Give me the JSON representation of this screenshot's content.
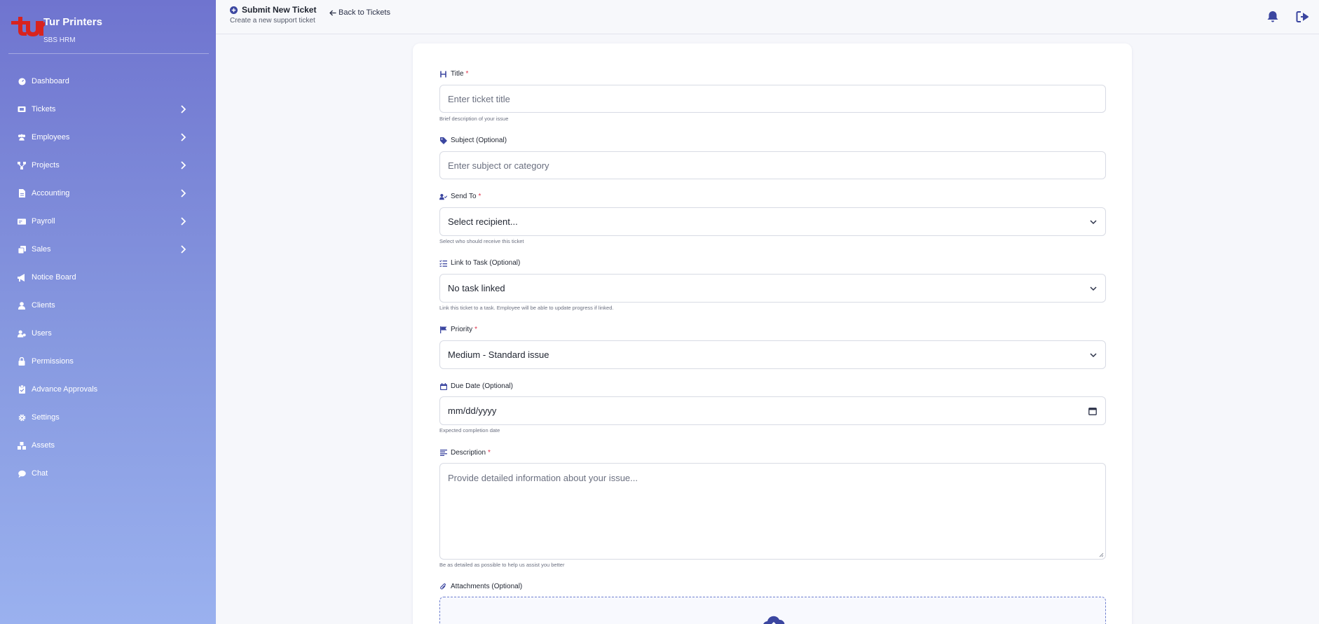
{
  "brand": {
    "name": "Tur Printers",
    "subtitle": "SBS HRM",
    "logo_text": "tur"
  },
  "sidebar": {
    "items": [
      {
        "label": "Dashboard",
        "icon": "dashboard-icon",
        "expandable": false
      },
      {
        "label": "Tickets",
        "icon": "ticket-icon",
        "expandable": true
      },
      {
        "label": "Employees",
        "icon": "users-group-icon",
        "expandable": true
      },
      {
        "label": "Projects",
        "icon": "project-diagram-icon",
        "expandable": true
      },
      {
        "label": "Accounting",
        "icon": "file-invoice-icon",
        "expandable": true
      },
      {
        "label": "Payroll",
        "icon": "money-check-icon",
        "expandable": true
      },
      {
        "label": "Sales",
        "icon": "copy-icon",
        "expandable": true
      },
      {
        "label": "Notice Board",
        "icon": "megaphone-icon",
        "expandable": false
      },
      {
        "label": "Clients",
        "icon": "user-icon",
        "expandable": false
      },
      {
        "label": "Users",
        "icon": "user-gear-icon",
        "expandable": false
      },
      {
        "label": "Permissions",
        "icon": "lock-icon",
        "expandable": false
      },
      {
        "label": "Advance Approvals",
        "icon": "clipboard-check-icon",
        "expandable": false
      },
      {
        "label": "Settings",
        "icon": "gear-icon",
        "expandable": false
      },
      {
        "label": "Assets",
        "icon": "boxes-icon",
        "expandable": false
      },
      {
        "label": "Chat",
        "icon": "chat-icon",
        "expandable": false
      }
    ]
  },
  "header": {
    "title": "Submit New Ticket",
    "subtitle": "Create a new support ticket",
    "back_label": "Back to Tickets"
  },
  "form": {
    "title": {
      "label": "Title",
      "required": "*",
      "placeholder": "Enter ticket title",
      "hint": "Brief description of your issue"
    },
    "subject": {
      "label": "Subject (Optional)",
      "placeholder": "Enter subject or category"
    },
    "send_to": {
      "label": "Send To",
      "required": "*",
      "value": "Select recipient...",
      "hint": "Select who should receive this ticket"
    },
    "link_task": {
      "label": "Link to Task (Optional)",
      "value": "No task linked",
      "hint": "Link this ticket to a task. Employee will be able to update progress if linked."
    },
    "priority": {
      "label": "Priority",
      "required": "*",
      "value": "Medium - Standard issue"
    },
    "due_date": {
      "label": "Due Date (Optional)",
      "value": "mm/dd/yyyy",
      "hint": "Expected completion date"
    },
    "description": {
      "label": "Description",
      "required": "*",
      "placeholder": "Provide detailed information about your issue...",
      "hint": "Be as detailed as possible to help us assist you better"
    },
    "attachments": {
      "label": "Attachments (Optional)"
    }
  },
  "colors": {
    "accent": "#3b46a0",
    "required": "#e0324b",
    "sidebar_top": "#6f74cf",
    "sidebar_bottom": "#9ab1ef",
    "logo_red": "#d8231f"
  }
}
